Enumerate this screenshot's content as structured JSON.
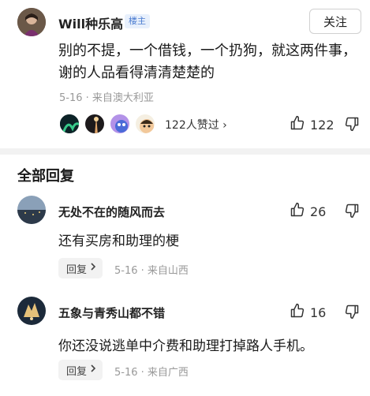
{
  "top_comment": {
    "username": "Will种乐高",
    "badge": "楼主",
    "follow_label": "关注",
    "text": "别的不提，一个借钱，一个扔狗，就这两件事，谢的人品看得清清楚楚的",
    "meta": "5-16 · 来自澳大利亚",
    "likers_text": "122人赞过 ›",
    "like_count": "122"
  },
  "section": {
    "title": "全部回复"
  },
  "replies": [
    {
      "username": "无处不在的随风而去",
      "like_count": "26",
      "text": "还有买房和助理的梗",
      "reply_label": "回复",
      "meta": "5-16 · 来自山西"
    },
    {
      "username": "五象与青秀山都不错",
      "like_count": "16",
      "text": "你还没说逃单中介费和助理打掉路人手机。",
      "reply_label": "回复",
      "meta": "5-16 · 来自广西"
    }
  ],
  "icons": [
    "thumb-up-icon",
    "thumb-down-icon",
    "chevron-right-icon"
  ],
  "colors": {
    "badge_text": "#4a7bd0",
    "badge_bg": "#e8f0fc",
    "meta": "#999999",
    "separator": "#f2f2f2"
  }
}
